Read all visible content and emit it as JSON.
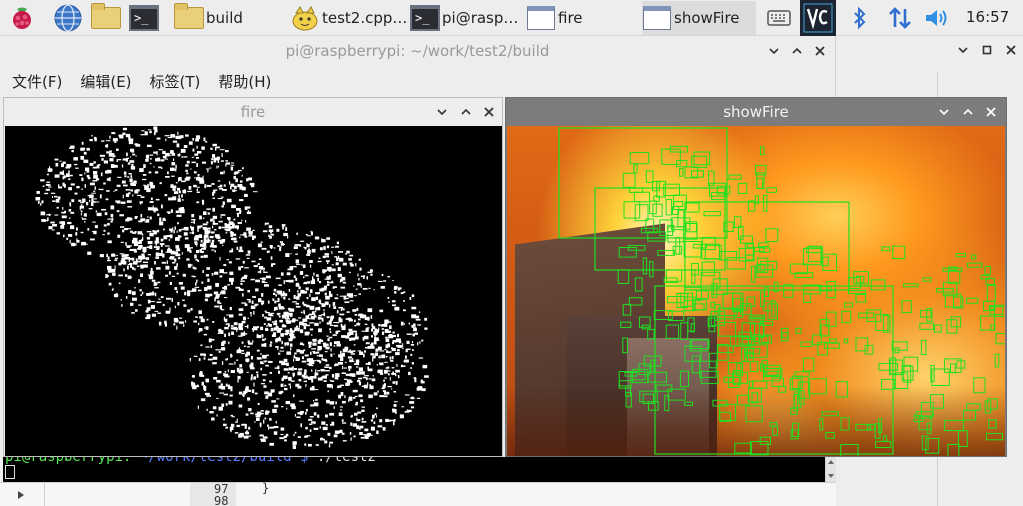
{
  "taskbar": {
    "tasks": [
      {
        "label": "build",
        "icon": "folder-icon"
      },
      {
        "label": "test2.cpp ...",
        "icon": "geany-icon"
      },
      {
        "label": "pi@raspb...",
        "icon": "terminal-icon"
      },
      {
        "label": "fire",
        "icon": "window-icon"
      },
      {
        "label": "showFire",
        "icon": "window-icon"
      }
    ],
    "clock": "16:57"
  },
  "terminal": {
    "title": "pi@raspberrypi: ~/work/test2/build",
    "menu": [
      "文件(F)",
      "编辑(E)",
      "标签(T)",
      "帮助(H)"
    ],
    "prompt_user": "pi@raspberrypi:",
    "prompt_path": "~/work/test2/build $",
    "prompt_cmd": " ./test2"
  },
  "fire_window": {
    "title": "fire"
  },
  "showfire_window": {
    "title": "showFire"
  },
  "editor": {
    "line1": "97",
    "line2": "98",
    "code": "}"
  },
  "colors": {
    "accent_green": "#20e020",
    "prompt_green": "#56e356",
    "prompt_blue": "#5b7cff"
  }
}
